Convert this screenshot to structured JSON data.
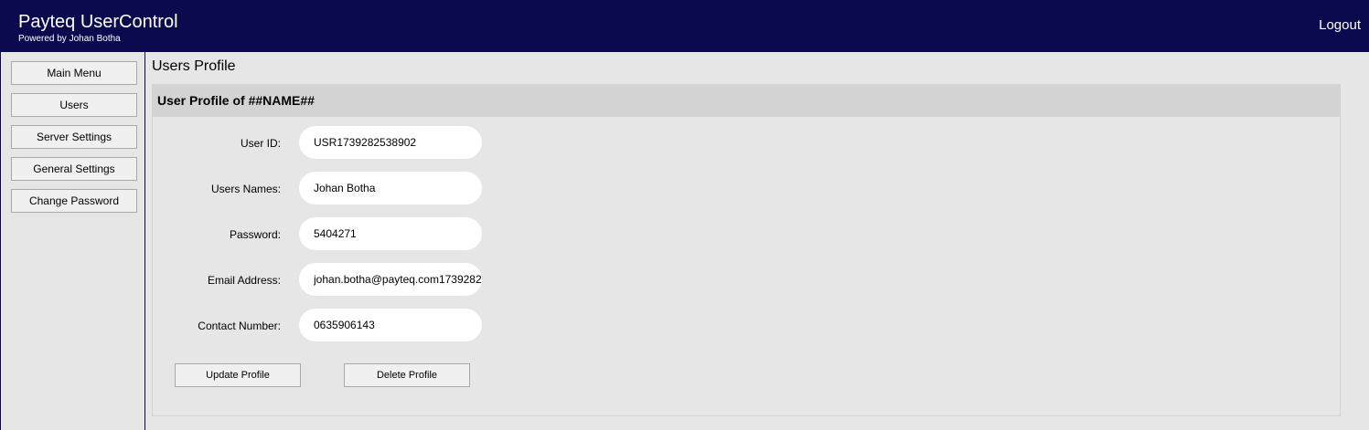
{
  "header": {
    "title": "Payteq UserControl",
    "subtitle": "Powered by Johan Botha",
    "logout_label": "Logout"
  },
  "sidebar": {
    "items": [
      {
        "label": "Main Menu"
      },
      {
        "label": "Users"
      },
      {
        "label": "Server Settings"
      },
      {
        "label": "General Settings"
      },
      {
        "label": "Change Password"
      }
    ]
  },
  "main": {
    "page_title": "Users Profile",
    "panel_title": "User Profile of ##NAME##",
    "fields": [
      {
        "label": "User ID:",
        "value": "USR1739282538902"
      },
      {
        "label": "Users Names:",
        "value": "Johan Botha"
      },
      {
        "label": "Password:",
        "value": "5404271"
      },
      {
        "label": "Email Address:",
        "value": "johan.botha@payteq.com1739282"
      },
      {
        "label": "Contact Number:",
        "value": "0635906143"
      }
    ],
    "update_label": "Update Profile",
    "delete_label": "Delete Profile"
  },
  "colors": {
    "header_bg": "#0c0a4f",
    "page_bg": "#e6e6e6",
    "panel_header_bg": "#d3d3d3"
  }
}
